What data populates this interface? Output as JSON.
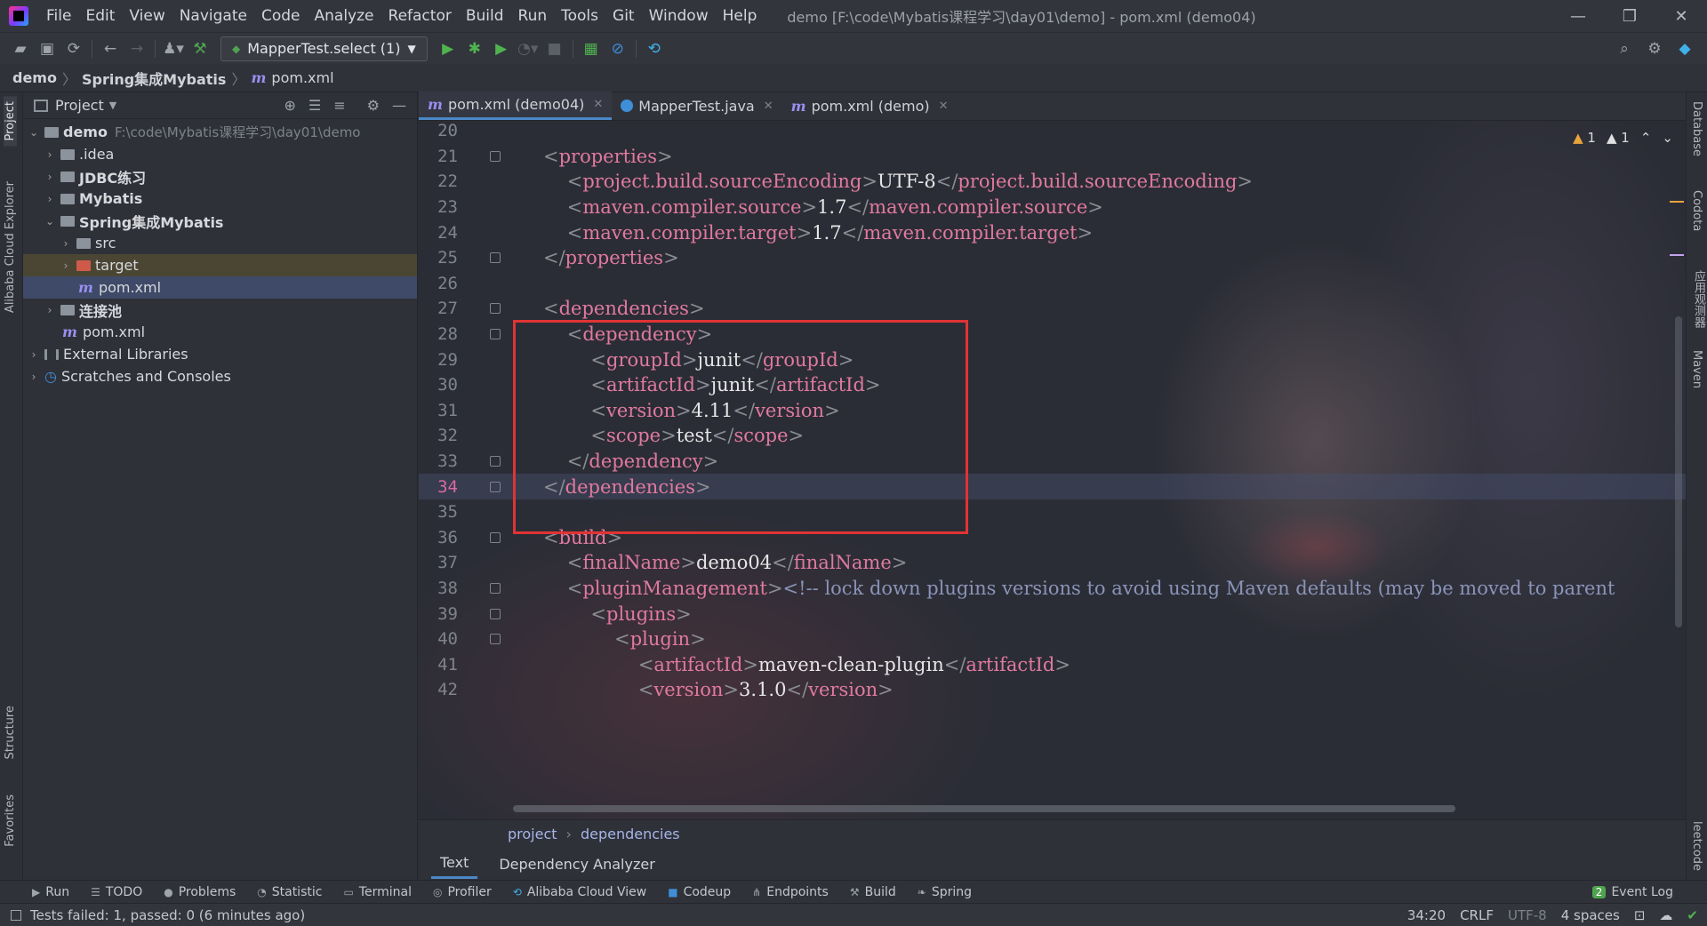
{
  "menu": [
    "File",
    "Edit",
    "View",
    "Navigate",
    "Code",
    "Analyze",
    "Refactor",
    "Build",
    "Run",
    "Tools",
    "Git",
    "Window",
    "Help"
  ],
  "window_title": "demo [F:\\code\\Mybatis课程学习\\day01\\demo] - pom.xml (demo04)",
  "toolbar": {
    "run_config": "MapperTest.select (1)"
  },
  "breadcrumb": {
    "project": "demo",
    "module": "Spring集成Mybatis",
    "file": "pom.xml"
  },
  "left_stripe": {
    "project": "Project",
    "alibaba": "Alibaba Cloud Explorer",
    "structure": "Structure",
    "favorites": "Favorites"
  },
  "right_stripe": {
    "database": "Database",
    "codota": "Codota",
    "app_inspector": "应用观测器",
    "maven": "Maven",
    "leetcode": "leetcode"
  },
  "project_panel": {
    "title": "Project",
    "tree": [
      {
        "label": "demo",
        "path": "F:\\code\\Mybatis课程学习\\day01\\demo"
      },
      {
        "label": ".idea"
      },
      {
        "label": "JDBC练习"
      },
      {
        "label": "Mybatis"
      },
      {
        "label": "Spring集成Mybatis"
      },
      {
        "label": "src"
      },
      {
        "label": "target"
      },
      {
        "label": "pom.xml"
      },
      {
        "label": "连接池"
      },
      {
        "label": "pom.xml"
      },
      {
        "label": "External Libraries"
      },
      {
        "label": "Scratches and Consoles"
      }
    ]
  },
  "tabs": [
    {
      "label": "pom.xml (demo04)"
    },
    {
      "label": "MapperTest.java"
    },
    {
      "label": "pom.xml (demo)"
    }
  ],
  "inspections": {
    "warnings": "1",
    "weak_warnings": "1"
  },
  "code_lines": [
    {
      "n": "20",
      "indent": "",
      "parts": []
    },
    {
      "n": "21",
      "indent": "",
      "parts": [
        [
          "b",
          "<"
        ],
        [
          "t",
          "properties"
        ],
        [
          "b",
          ">"
        ]
      ]
    },
    {
      "n": "22",
      "indent": "    ",
      "parts": [
        [
          "b",
          "<"
        ],
        [
          "t",
          "project.build.sourceEncoding"
        ],
        [
          "b",
          ">"
        ],
        [
          "x",
          "UTF-8"
        ],
        [
          "b",
          "</"
        ],
        [
          "t",
          "project.build.sourceEncoding"
        ],
        [
          "b",
          ">"
        ]
      ]
    },
    {
      "n": "23",
      "indent": "    ",
      "parts": [
        [
          "b",
          "<"
        ],
        [
          "t",
          "maven.compiler.source"
        ],
        [
          "b",
          ">"
        ],
        [
          "x",
          "1.7"
        ],
        [
          "b",
          "</"
        ],
        [
          "t",
          "maven.compiler.source"
        ],
        [
          "b",
          ">"
        ]
      ]
    },
    {
      "n": "24",
      "indent": "    ",
      "parts": [
        [
          "b",
          "<"
        ],
        [
          "t",
          "maven.compiler.target"
        ],
        [
          "b",
          ">"
        ],
        [
          "x",
          "1.7"
        ],
        [
          "b",
          "</"
        ],
        [
          "t",
          "maven.compiler.target"
        ],
        [
          "b",
          ">"
        ]
      ]
    },
    {
      "n": "25",
      "indent": "",
      "parts": [
        [
          "b",
          "</"
        ],
        [
          "t",
          "properties"
        ],
        [
          "b",
          ">"
        ]
      ]
    },
    {
      "n": "26",
      "indent": "",
      "parts": []
    },
    {
      "n": "27",
      "indent": "",
      "parts": [
        [
          "b",
          "<"
        ],
        [
          "t",
          "dependencies"
        ],
        [
          "b",
          ">"
        ]
      ]
    },
    {
      "n": "28",
      "indent": "    ",
      "parts": [
        [
          "b",
          "<"
        ],
        [
          "t",
          "dependency"
        ],
        [
          "b",
          ">"
        ]
      ]
    },
    {
      "n": "29",
      "indent": "        ",
      "parts": [
        [
          "b",
          "<"
        ],
        [
          "t",
          "groupId"
        ],
        [
          "b",
          ">"
        ],
        [
          "x",
          "junit"
        ],
        [
          "b",
          "</"
        ],
        [
          "t",
          "groupId"
        ],
        [
          "b",
          ">"
        ]
      ]
    },
    {
      "n": "30",
      "indent": "        ",
      "parts": [
        [
          "b",
          "<"
        ],
        [
          "t",
          "artifactId"
        ],
        [
          "b",
          ">"
        ],
        [
          "x",
          "junit"
        ],
        [
          "b",
          "</"
        ],
        [
          "t",
          "artifactId"
        ],
        [
          "b",
          ">"
        ]
      ]
    },
    {
      "n": "31",
      "indent": "        ",
      "parts": [
        [
          "b",
          "<"
        ],
        [
          "t",
          "version"
        ],
        [
          "b",
          ">"
        ],
        [
          "x",
          "4.11"
        ],
        [
          "b",
          "</"
        ],
        [
          "t",
          "version"
        ],
        [
          "b",
          ">"
        ]
      ]
    },
    {
      "n": "32",
      "indent": "        ",
      "parts": [
        [
          "b",
          "<"
        ],
        [
          "t",
          "scope"
        ],
        [
          "b",
          ">"
        ],
        [
          "x",
          "test"
        ],
        [
          "b",
          "</"
        ],
        [
          "t",
          "scope"
        ],
        [
          "b",
          ">"
        ]
      ]
    },
    {
      "n": "33",
      "indent": "    ",
      "parts": [
        [
          "b",
          "</"
        ],
        [
          "t",
          "dependency"
        ],
        [
          "b",
          ">"
        ]
      ]
    },
    {
      "n": "34",
      "indent": "",
      "parts": [
        [
          "b",
          "</"
        ],
        [
          "t",
          "dependencies"
        ],
        [
          "b",
          ">"
        ]
      ]
    },
    {
      "n": "35",
      "indent": "",
      "parts": []
    },
    {
      "n": "36",
      "indent": "",
      "parts": [
        [
          "b",
          "<"
        ],
        [
          "t",
          "build"
        ],
        [
          "b",
          ">"
        ]
      ]
    },
    {
      "n": "37",
      "indent": "    ",
      "parts": [
        [
          "b",
          "<"
        ],
        [
          "t",
          "finalName"
        ],
        [
          "b",
          ">"
        ],
        [
          "x",
          "demo04"
        ],
        [
          "b",
          "</"
        ],
        [
          "t",
          "finalName"
        ],
        [
          "b",
          ">"
        ]
      ]
    },
    {
      "n": "38",
      "indent": "    ",
      "parts": [
        [
          "b",
          "<"
        ],
        [
          "t",
          "pluginManagement"
        ],
        [
          "b",
          ">"
        ],
        [
          "c",
          "<!-- lock down plugins versions to avoid using Maven defaults (may be moved to parent"
        ]
      ]
    },
    {
      "n": "39",
      "indent": "        ",
      "parts": [
        [
          "b",
          "<"
        ],
        [
          "t",
          "plugins"
        ],
        [
          "b",
          ">"
        ]
      ]
    },
    {
      "n": "40",
      "indent": "            ",
      "parts": [
        [
          "b",
          "<"
        ],
        [
          "t",
          "plugin"
        ],
        [
          "b",
          ">"
        ]
      ]
    },
    {
      "n": "41",
      "indent": "                ",
      "parts": [
        [
          "b",
          "<"
        ],
        [
          "t",
          "artifactId"
        ],
        [
          "b",
          ">"
        ],
        [
          "x",
          "maven-clean-plugin"
        ],
        [
          "b",
          "</"
        ],
        [
          "t",
          "artifactId"
        ],
        [
          "b",
          ">"
        ]
      ]
    },
    {
      "n": "42",
      "indent": "                ",
      "parts": [
        [
          "b",
          "<"
        ],
        [
          "t",
          "version"
        ],
        [
          "b",
          ">"
        ],
        [
          "x",
          "3.1.0"
        ],
        [
          "b",
          "</"
        ],
        [
          "t",
          "version"
        ],
        [
          "b",
          ">"
        ]
      ]
    }
  ],
  "current_line": "34",
  "editor_breadcrumb": [
    "project",
    "dependencies"
  ],
  "editor_bottom_tabs": [
    "Text",
    "Dependency Analyzer"
  ],
  "tool_windows": [
    "Run",
    "TODO",
    "Problems",
    "Statistic",
    "Terminal",
    "Profiler",
    "Alibaba Cloud View",
    "Codeup",
    "Endpoints",
    "Build",
    "Spring"
  ],
  "event_log": {
    "count": "2",
    "label": "Event Log"
  },
  "status": {
    "message": "Tests failed: 1, passed: 0 (6 minutes ago)",
    "position": "34:20",
    "line_sep": "CRLF",
    "encoding": "UTF-8",
    "indent": "4 spaces"
  },
  "colors": {
    "tag": "#e07a9e",
    "highlight_box": "#e03434",
    "accent": "#4a88c7"
  }
}
